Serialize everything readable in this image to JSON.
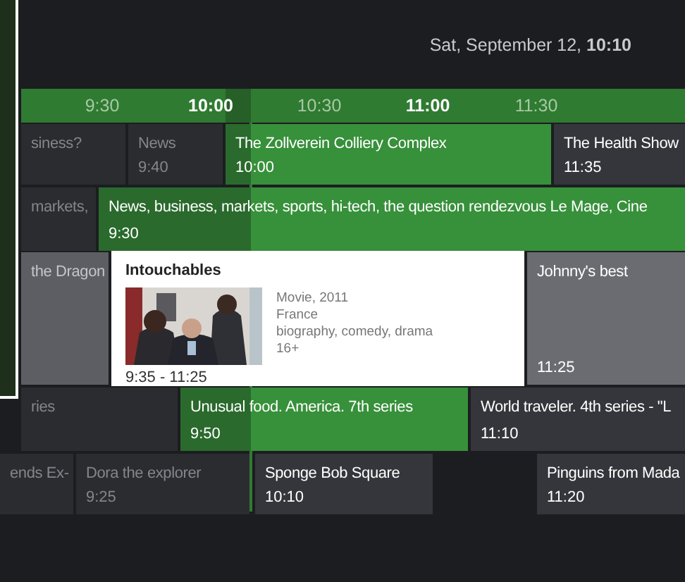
{
  "header": {
    "date": "Sat, September 12, **10:10**"
  },
  "timeline": [
    {
      "label": "9:30",
      "kind": "half"
    },
    {
      "label": "10:00",
      "kind": "hour"
    },
    {
      "label": "10:30",
      "kind": "half"
    },
    {
      "label": "11:00",
      "kind": "hour"
    },
    {
      "label": "11:30",
      "kind": "half"
    }
  ],
  "rows": [
    {
      "selected": false,
      "programs": [
        {
          "title": "siness?",
          "ended": true,
          "on_air": false
        },
        {
          "title": "News",
          "time": "9:40",
          "ended": true,
          "on_air": false
        },
        {
          "title": "The Zollverein Colliery Complex",
          "time": "10:00",
          "ended": false,
          "on_air": true
        },
        {
          "title": "The Health Show",
          "time": "11:35",
          "ended": false,
          "on_air": false
        }
      ]
    },
    {
      "selected": false,
      "programs": [
        {
          "title": "markets,",
          "ended": true,
          "on_air": false
        },
        {
          "title": "News, business, markets, sports, hi-tech, the question rendezvous Le Mage, Cine",
          "time": "9:30",
          "ended": false,
          "on_air": true
        }
      ]
    },
    {
      "selected": true,
      "programs": [
        {
          "title": "the Dragon",
          "ended": true,
          "on_air": false
        },
        {
          "kind": "popup"
        },
        {
          "title": "Johnny's best",
          "time": "11:25",
          "ended": false,
          "on_air": false
        }
      ]
    },
    {
      "selected": false,
      "programs": [
        {
          "title": "ries",
          "ended": true,
          "on_air": false
        },
        {
          "title": "Unusual food. America. 7th series",
          "time": "9:50",
          "ended": false,
          "on_air": true
        },
        {
          "title": "World traveler. 4th series - \"L",
          "time": "11:10",
          "ended": false,
          "on_air": false
        }
      ]
    },
    {
      "selected": false,
      "programs": [
        {
          "title": "ends Ex-",
          "ended": true,
          "on_air": false
        },
        {
          "title": "Dora the explorer",
          "time": "9:25",
          "ended": true,
          "on_air": false
        },
        {
          "title": "Sponge Bob Square",
          "time": "10:10",
          "ended": false,
          "on_air": false
        },
        {
          "title": "Pinguins from Mada",
          "time": "11:20",
          "ended": false,
          "on_air": false
        }
      ]
    }
  ],
  "popup": {
    "title": "Intouchables",
    "info": [
      "Movie, 2011",
      "France",
      "biography, comedy, drama",
      "16+"
    ],
    "time": "9:35 - 11:25"
  }
}
